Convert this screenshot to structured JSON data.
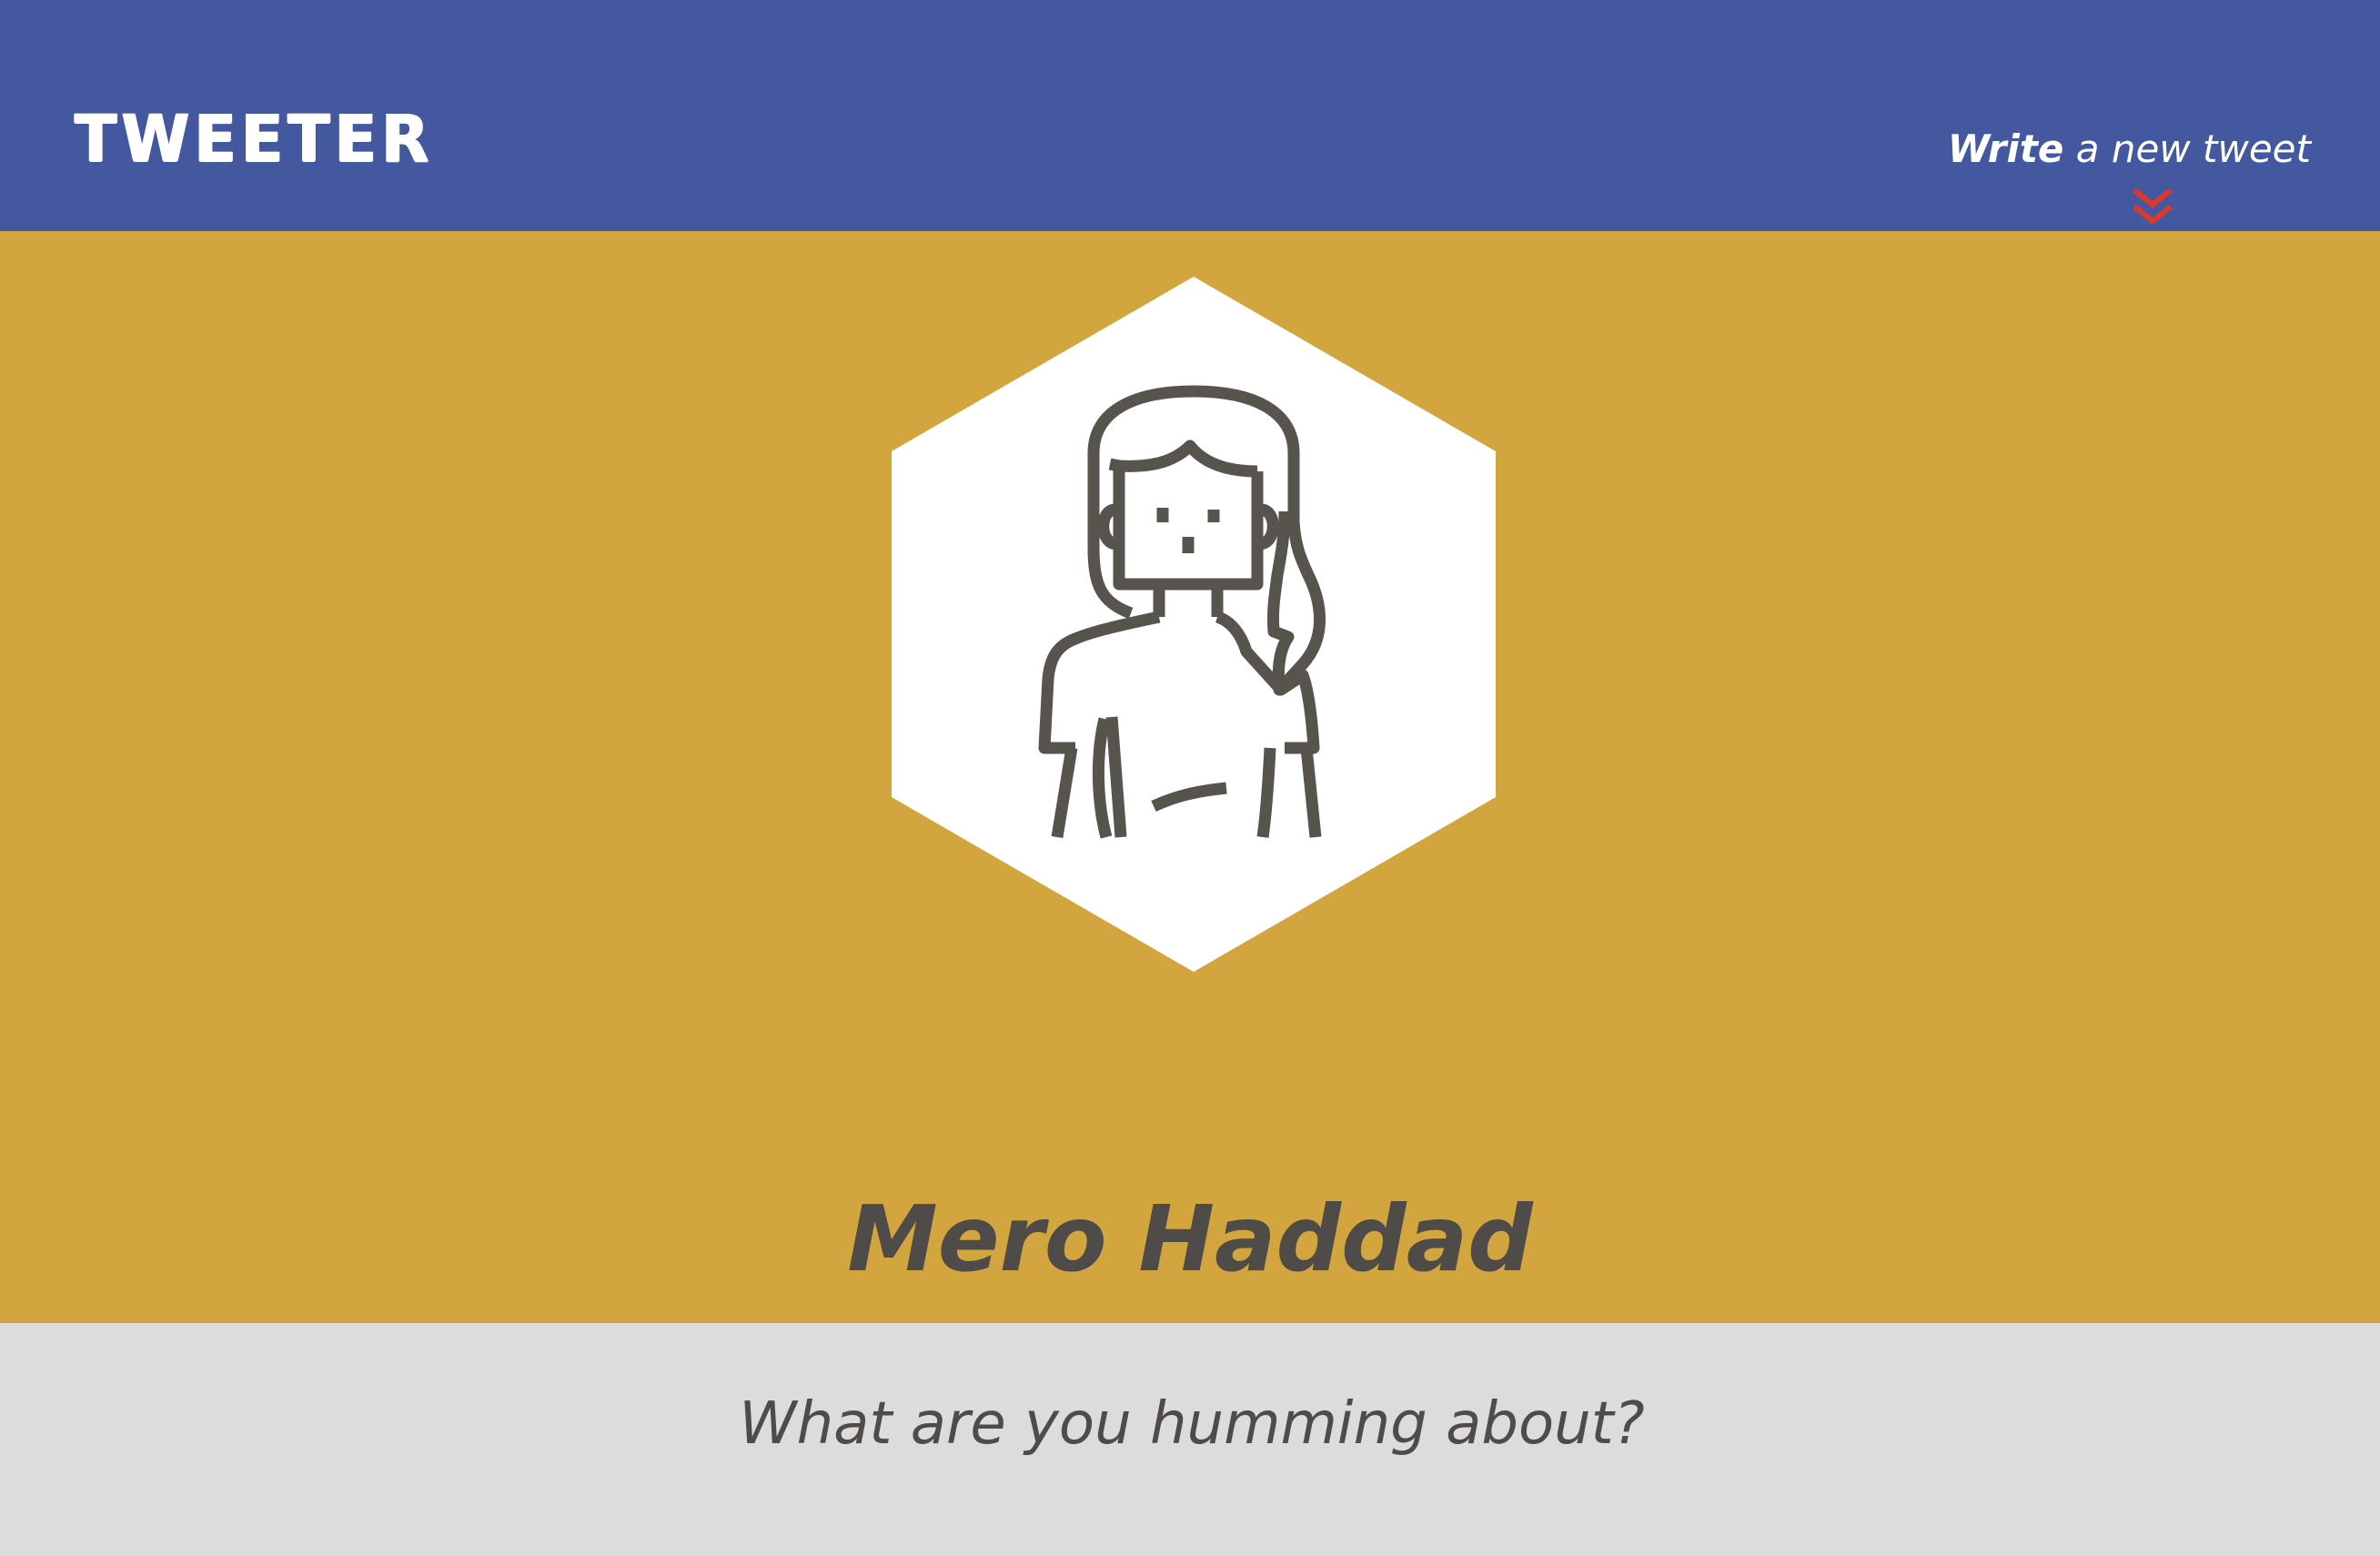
{
  "brand": {
    "name": "TWEETER"
  },
  "header": {
    "compose_strong": "Write",
    "compose_rest": " a new tweet",
    "chevron_icon": "double-chevron-down-icon",
    "chevron_color": "#d93a2c"
  },
  "profile": {
    "name": "Mero Haddad",
    "avatar_icon": "woman-avatar-icon"
  },
  "compose": {
    "placeholder": "What are you humming about?",
    "value": ""
  },
  "colors": {
    "navbar": "#4458a0",
    "profile_background": "#d3a53f",
    "compose_background": "#dcdcdc",
    "text_dark": "#4e4b48",
    "text_light": "#ffffff"
  }
}
